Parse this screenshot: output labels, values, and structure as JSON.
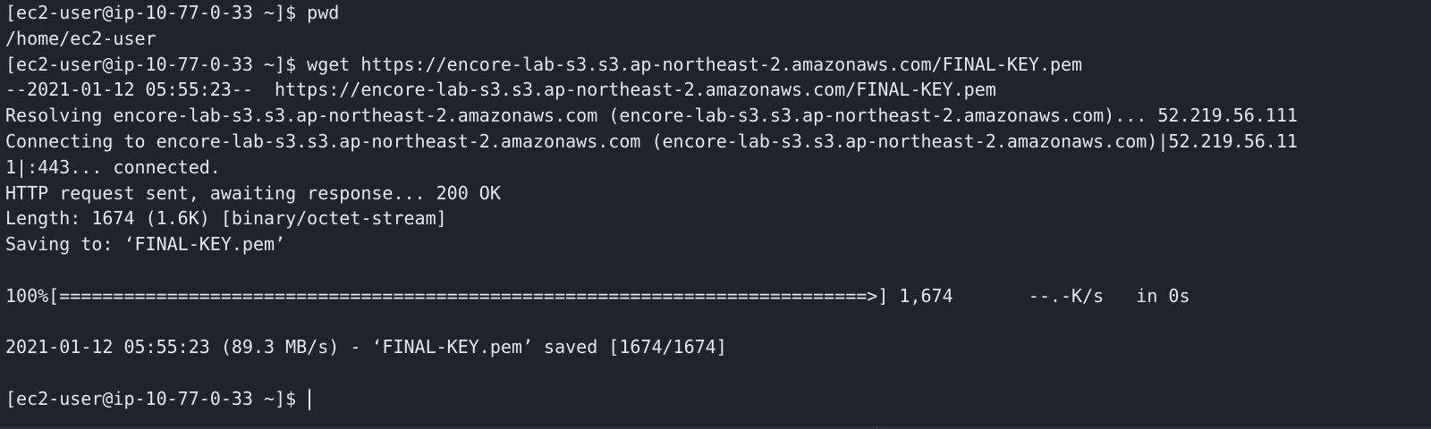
{
  "terminal": {
    "lines": [
      "[ec2-user@ip-10-77-0-33 ~]$ pwd",
      "/home/ec2-user",
      "[ec2-user@ip-10-77-0-33 ~]$ wget https://encore-lab-s3.s3.ap-northeast-2.amazonaws.com/FINAL-KEY.pem",
      "--2021-01-12 05:55:23--  https://encore-lab-s3.s3.ap-northeast-2.amazonaws.com/FINAL-KEY.pem",
      "Resolving encore-lab-s3.s3.ap-northeast-2.amazonaws.com (encore-lab-s3.s3.ap-northeast-2.amazonaws.com)... 52.219.56.111",
      "Connecting to encore-lab-s3.s3.ap-northeast-2.amazonaws.com (encore-lab-s3.s3.ap-northeast-2.amazonaws.com)|52.219.56.11",
      "1|:443... connected.",
      "HTTP request sent, awaiting response... 200 OK",
      "Length: 1674 (1.6K) [binary/octet-stream]",
      "Saving to: ‘FINAL-KEY.pem’",
      "",
      "100%[===========================================================================>] 1,674       --.-K/s   in 0s",
      "",
      "2021-01-12 05:55:23 (89.3 MB/s) - ‘FINAL-KEY.pem’ saved [1674/1674]",
      "",
      "[ec2-user@ip-10-77-0-33 ~]$ "
    ],
    "colors": {
      "background": "#1f232b",
      "foreground": "#e6e8eb"
    }
  }
}
